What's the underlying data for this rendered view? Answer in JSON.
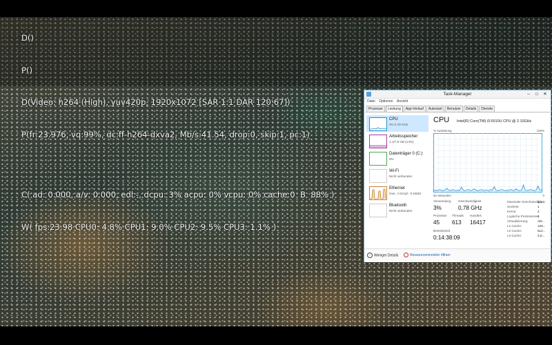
{
  "osd": {
    "lines": [
      "D()",
      "P()",
      "D(Video: h264 (High), yuv420p, 1920x1072 [SAR 1:1 DAR 120:67])",
      "P(fr:23.976, vq:99%, dc:ff-h264-dxva2, Mb/s:41.54, drop:0, skip:1, pc:1)",
      "C( ad: 0.000, a/v: 0.000, edl:-, dcpu: 3% acpu: 0% vcpu: 0% cache:0  B  88% )",
      "W( fps:23.98 CPU0: 4.8% CPU1: 9.0% CPU2: 9.5% CPU3: 1.1% )"
    ]
  },
  "taskmanager": {
    "title": "Task-Manager",
    "window_buttons": [
      "–",
      "□",
      "✕"
    ],
    "menu": [
      "Datei",
      "Optionen",
      "Ansicht"
    ],
    "tabs": [
      "Prozesse",
      "Leistung",
      "App-Verlauf",
      "Autostart",
      "Benutzer",
      "Details",
      "Dienste"
    ],
    "active_tab": "Leistung",
    "resources": [
      {
        "name": "CPU",
        "sub": "3% 0,78 GHz",
        "color": "#1e90d0",
        "active": true
      },
      {
        "name": "Arbeitsspeicher",
        "sub": "1,1/7,9 GB (14%)",
        "color": "#a33ba3",
        "active": false
      },
      {
        "name": "Datenträger 0 (C:)",
        "sub": "0%",
        "color": "#4ca64c",
        "active": false
      },
      {
        "name": "Wi-Fi",
        "sub": "Nicht verbunden",
        "color": "#c87f2a",
        "active": false
      },
      {
        "name": "Ethernet",
        "sub": "Ges.: 0 Empf.: 8 KBit/s",
        "color": "#c87f2a",
        "active": false
      },
      {
        "name": "Bluetooth",
        "sub": "Nicht verbunden",
        "color": "#c87f2a",
        "active": false
      }
    ],
    "cpu_heading": "CPU",
    "cpu_model": "Intel(R) Core(TM) i3-5010U CPU @ 2.10GHz",
    "graph_label_top_left": "% Auslastung",
    "graph_label_top_right": "100%",
    "graph_label_bottom_left": "60 Sekunden",
    "graph_label_bottom_right": "0",
    "graph_color": "#1e90d0",
    "utilization_series": [
      2,
      3,
      2,
      4,
      3,
      2,
      3,
      6,
      3,
      2,
      4,
      3,
      2,
      3,
      2,
      8,
      3,
      2,
      3,
      4,
      2,
      3,
      5,
      3,
      2,
      3,
      4,
      2,
      3,
      3,
      2,
      4,
      3,
      9,
      3,
      2,
      3,
      4,
      3,
      2,
      3,
      2,
      4,
      3,
      2,
      5,
      3,
      2,
      3,
      12,
      3,
      2,
      3,
      4,
      3,
      2,
      3,
      10,
      3,
      3
    ],
    "stats": {
      "verwendung_label": "Verwendung",
      "verwendung": "3%",
      "ghz_label": "Geschwindigkeit",
      "ghz": "0,78 GHz",
      "prozesse_label": "Prozesse",
      "prozesse": "45",
      "threads_label": "Threads",
      "threads": "613",
      "handles_label": "Handles",
      "handles": "16417",
      "betriebszeit_label": "Betriebszeit",
      "betriebszeit": "0:14:38:09"
    },
    "specs": [
      {
        "label": "Maximale Geschwindigkeit:",
        "value": "2,1..."
      },
      {
        "label": "Sockets:",
        "value": "1"
      },
      {
        "label": "Kerne:",
        "value": "2"
      },
      {
        "label": "Logische Prozessoren:",
        "value": "4"
      },
      {
        "label": "Virtualisierung:",
        "value": "Akt..."
      },
      {
        "label": "L1-Cache:",
        "value": "128..."
      },
      {
        "label": "L2-Cache:",
        "value": "512..."
      },
      {
        "label": "L3-Cache:",
        "value": "3,0..."
      }
    ],
    "footer_less": "Weniger Details",
    "footer_resmon": "Ressourcenmonitor öffnen"
  }
}
